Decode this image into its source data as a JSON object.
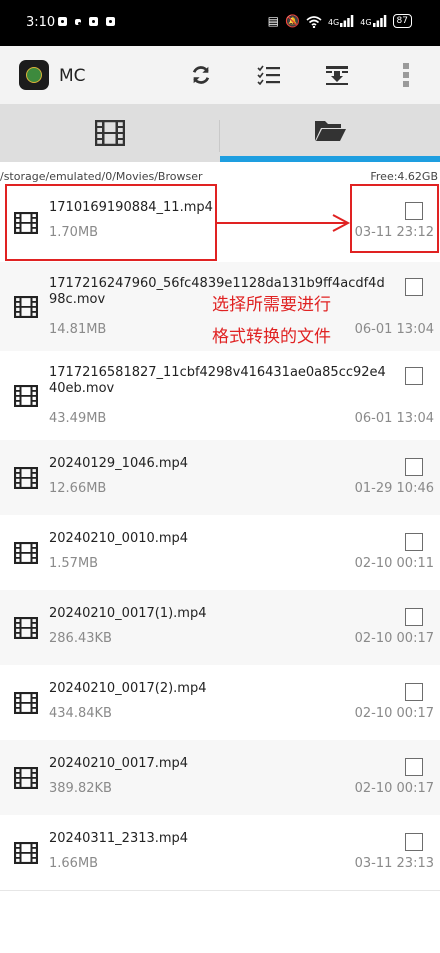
{
  "status_bar": {
    "time": "3:10",
    "signal1": "4G",
    "signal2": "4G",
    "battery": "87"
  },
  "app_bar": {
    "title": "MC",
    "buttons": [
      {
        "name": "refresh-button",
        "icon": "refresh-icon"
      },
      {
        "name": "checklist-button",
        "icon": "checklist-icon"
      },
      {
        "name": "import-button",
        "icon": "import-icon"
      },
      {
        "name": "more-button",
        "icon": "more-vert-icon"
      }
    ]
  },
  "tabs": [
    {
      "name": "tab-videos",
      "icon": "film-icon",
      "active": false
    },
    {
      "name": "tab-browser",
      "icon": "folder-open-icon",
      "active": true
    }
  ],
  "path_bar": {
    "path": "/storage/emulated/0/Movies/Browser",
    "free": "Free:4.62GB"
  },
  "files": [
    {
      "name": "1710169190884_11.mp4",
      "size": "1.70MB",
      "date": "03-11 23:12"
    },
    {
      "name": "1717216247960_56fc4839e1128da131b9ff4acdf4d98c.mov",
      "size": "14.81MB",
      "date": "06-01 13:04"
    },
    {
      "name": "1717216581827_11cbf4298v416431ae0a85cc92e440eb.mov",
      "size": "43.49MB",
      "date": "06-01 13:04"
    },
    {
      "name": "20240129_1046.mp4",
      "size": "12.66MB",
      "date": "01-29 10:46"
    },
    {
      "name": "20240210_0010.mp4",
      "size": "1.57MB",
      "date": "02-10 00:11"
    },
    {
      "name": "20240210_0017(1).mp4",
      "size": "286.43KB",
      "date": "02-10 00:17"
    },
    {
      "name": "20240210_0017(2).mp4",
      "size": "434.84KB",
      "date": "02-10 00:17"
    },
    {
      "name": "20240210_0017.mp4",
      "size": "389.82KB",
      "date": "02-10 00:17"
    },
    {
      "name": "20240311_2313.mp4",
      "size": "1.66MB",
      "date": "03-11 23:13"
    }
  ],
  "annotation": {
    "line1": "选择所需要进行",
    "line2": "格式转换的文件",
    "color": "#e02222"
  },
  "colors": {
    "accent": "#1e9ee0",
    "annotation": "#e02222"
  }
}
